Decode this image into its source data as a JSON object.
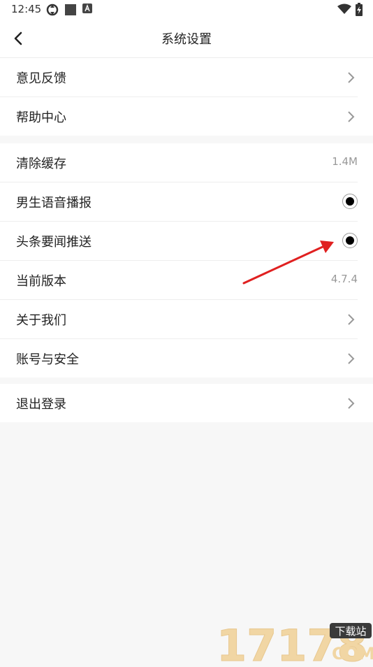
{
  "status": {
    "time": "12:45",
    "icons": [
      "sync-icon",
      "square-icon",
      "font-a-icon",
      "wifi-icon",
      "battery-charging-icon"
    ]
  },
  "header": {
    "back_icon": "chevron-left-icon",
    "title": "系统设置"
  },
  "groups": [
    {
      "items": [
        {
          "label": "意见反馈",
          "type": "link"
        },
        {
          "label": "帮助中心",
          "type": "link"
        }
      ]
    },
    {
      "items": [
        {
          "label": "清除缓存",
          "type": "value",
          "value": "1.4M"
        },
        {
          "label": "男生语音播报",
          "type": "radio",
          "selected": true
        },
        {
          "label": "头条要闻推送",
          "type": "radio",
          "selected": true
        },
        {
          "label": "当前版本",
          "type": "value",
          "value": "4.7.4"
        },
        {
          "label": "关于我们",
          "type": "link"
        },
        {
          "label": "账号与安全",
          "type": "link"
        }
      ]
    },
    {
      "items": [
        {
          "label": "退出登录",
          "type": "link"
        }
      ]
    }
  ],
  "colors": {
    "background": "#f7f7f7",
    "row_background": "#ffffff",
    "annotation_arrow": "#e02020"
  },
  "watermark": {
    "number": "17178",
    "tag": "下载站",
    "domain": "COM"
  }
}
